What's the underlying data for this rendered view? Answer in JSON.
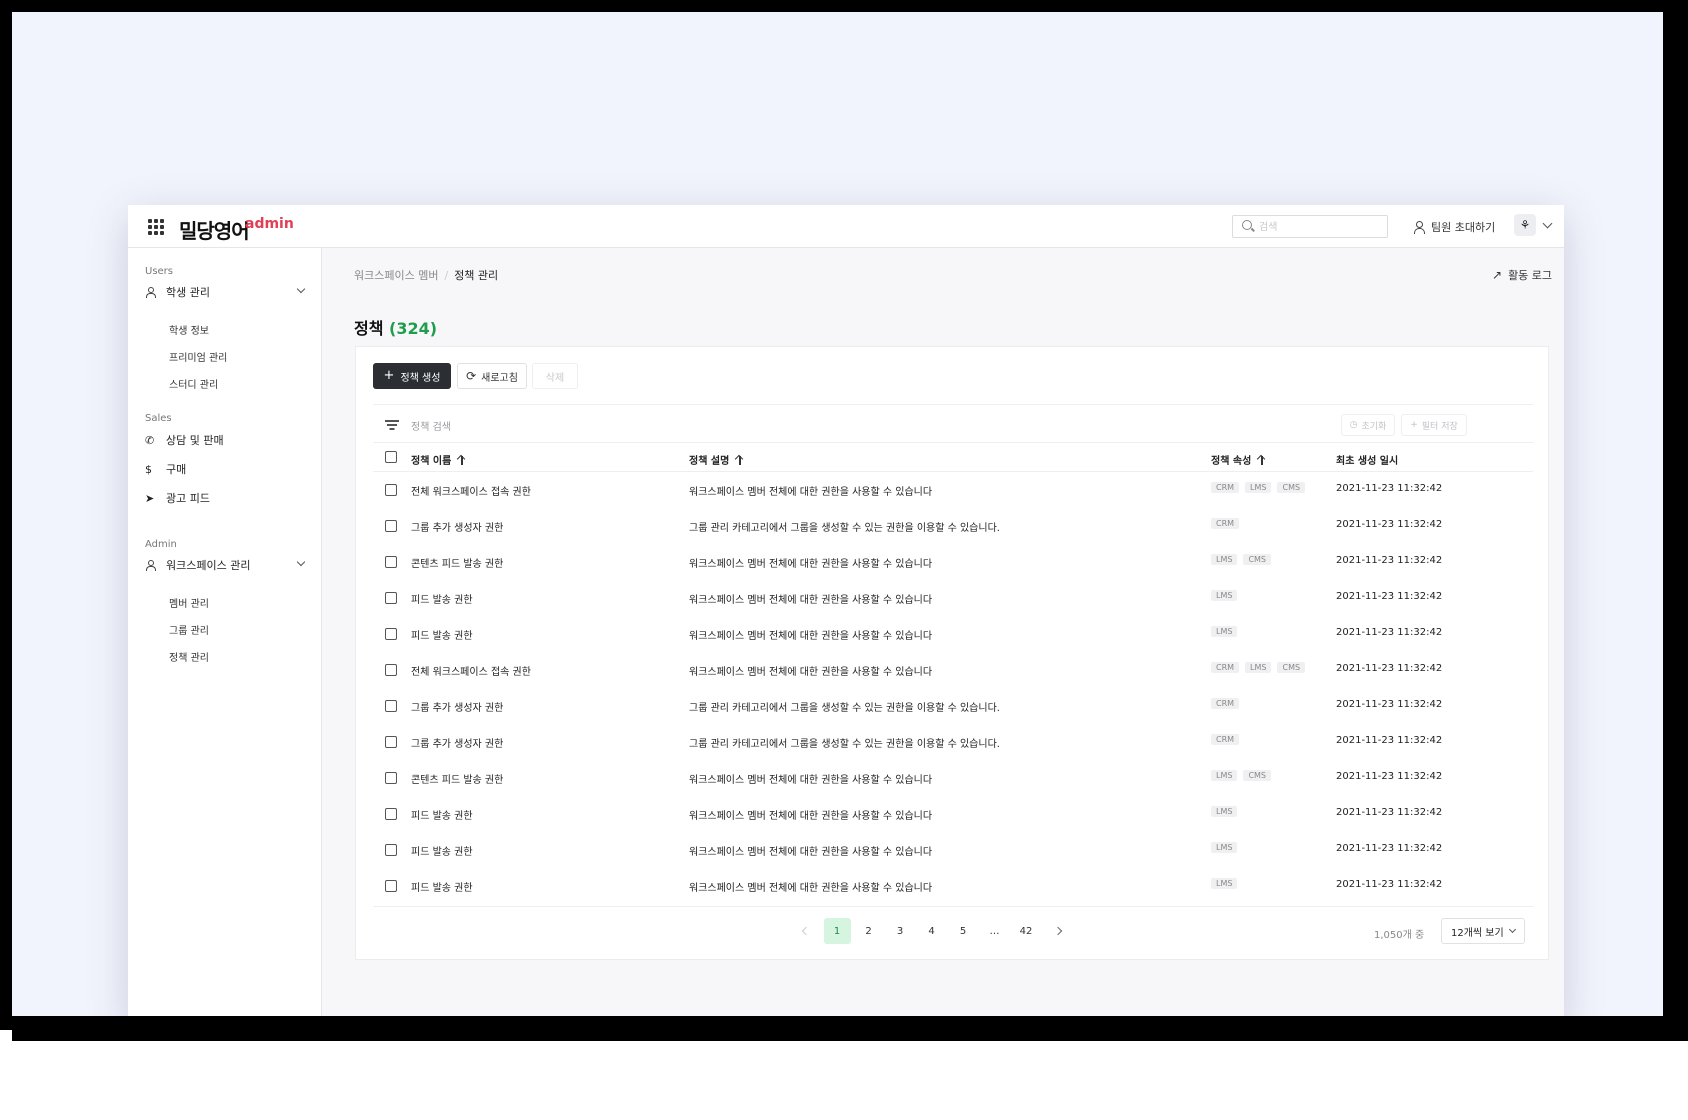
{
  "header": {
    "logo_text": "밀당영어",
    "logo_suffix": "admin",
    "search_placeholder": "검색",
    "invite_label": "팀원 초대하기",
    "avatar_glyph": "⚘"
  },
  "sidebar": {
    "sections": [
      {
        "label": "Users"
      },
      {
        "label": "Sales"
      },
      {
        "label": "Admin"
      }
    ],
    "users_item": "학생 관리",
    "users_sub": [
      "학생 정보",
      "프리미엄 관리",
      "스터디 관리"
    ],
    "sales_items": [
      "상담 및 판매",
      "구매",
      "광고 피드"
    ],
    "admin_item": "워크스페이스 관리",
    "admin_sub": [
      "멤버 관리",
      "그룹 관리",
      "정책 관리"
    ]
  },
  "breadcrumb": {
    "parent": "워크스페이스 멤버",
    "separator": "/",
    "current": "정책 관리"
  },
  "activity_label": "활동 로그",
  "page": {
    "title": "정책",
    "count": "(324)"
  },
  "toolbar": {
    "create": "정책 생성",
    "refresh": "새로고침",
    "delete": "삭제"
  },
  "filter": {
    "placeholder": "정책 검색",
    "reset": "초기화",
    "save": "필터 저장"
  },
  "table": {
    "headers": [
      "정책 이름",
      "정책 설명",
      "정책 속성",
      "최초 생성 일시"
    ],
    "rows": [
      {
        "name": "전체 워크스페이스 접속 권한",
        "desc": "워크스페이스 멤버 전체에 대한 권한을 사용할 수 있습니다",
        "tags": [
          "CRM",
          "LMS",
          "CMS"
        ],
        "date": "2021-11-23 11:32:42"
      },
      {
        "name": "그룹 추가 생성자 권한",
        "desc": "그룹 관리 카테고리에서 그룹을 생성할 수 있는 권한을 이용할 수 있습니다.",
        "tags": [
          "CRM"
        ],
        "date": "2021-11-23 11:32:42"
      },
      {
        "name": "콘텐츠 피드 발송 권한",
        "desc": "워크스페이스 멤버 전체에 대한 권한을 사용할 수 있습니다",
        "tags": [
          "LMS",
          "CMS"
        ],
        "date": "2021-11-23 11:32:42"
      },
      {
        "name": "피드 발송 권한",
        "desc": "워크스페이스 멤버 전체에 대한 권한을 사용할 수 있습니다",
        "tags": [
          "LMS"
        ],
        "date": "2021-11-23 11:32:42"
      },
      {
        "name": "피드 발송 권한",
        "desc": "워크스페이스 멤버 전체에 대한 권한을 사용할 수 있습니다",
        "tags": [
          "LMS"
        ],
        "date": "2021-11-23 11:32:42"
      },
      {
        "name": "전체 워크스페이스 접속 권한",
        "desc": "워크스페이스 멤버 전체에 대한 권한을 사용할 수 있습니다",
        "tags": [
          "CRM",
          "LMS",
          "CMS"
        ],
        "date": "2021-11-23 11:32:42"
      },
      {
        "name": "그룹 추가 생성자 권한",
        "desc": "그룹 관리 카테고리에서 그룹을 생성할 수 있는 권한을 이용할 수 있습니다.",
        "tags": [
          "CRM"
        ],
        "date": "2021-11-23 11:32:42"
      },
      {
        "name": "그룹 추가 생성자 권한",
        "desc": "그룹 관리 카테고리에서 그룹을 생성할 수 있는 권한을 이용할 수 있습니다.",
        "tags": [
          "CRM"
        ],
        "date": "2021-11-23 11:32:42"
      },
      {
        "name": "콘텐츠 피드 발송 권한",
        "desc": "워크스페이스 멤버 전체에 대한 권한을 사용할 수 있습니다",
        "tags": [
          "LMS",
          "CMS"
        ],
        "date": "2021-11-23 11:32:42"
      },
      {
        "name": "피드 발송 권한",
        "desc": "워크스페이스 멤버 전체에 대한 권한을 사용할 수 있습니다",
        "tags": [
          "LMS"
        ],
        "date": "2021-11-23 11:32:42"
      },
      {
        "name": "피드 발송 권한",
        "desc": "워크스페이스 멤버 전체에 대한 권한을 사용할 수 있습니다",
        "tags": [
          "LMS"
        ],
        "date": "2021-11-23 11:32:42"
      },
      {
        "name": "피드 발송 권한",
        "desc": "워크스페이스 멤버 전체에 대한 권한을 사용할 수 있습니다",
        "tags": [
          "LMS"
        ],
        "date": "2021-11-23 11:32:42"
      }
    ]
  },
  "pagination": {
    "pages": [
      "1",
      "2",
      "3",
      "4",
      "5",
      "…",
      "42"
    ],
    "current": "1",
    "total_label": "1,050개 중",
    "per_page_label": "12개씩 보기"
  },
  "colors": {
    "accent": "#1f9d4d",
    "brand": "#e23f55",
    "primary_button": "#2b2e33",
    "active_page_bg": "#d5f5e0"
  }
}
